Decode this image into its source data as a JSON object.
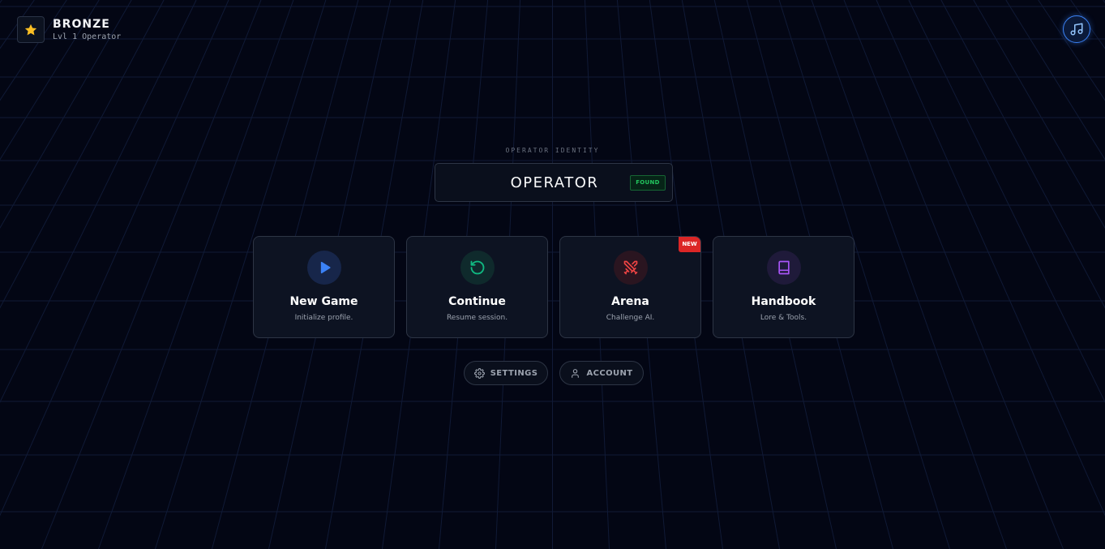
{
  "rank": {
    "title": "BRONZE",
    "subtitle": "Lvl 1 Operator",
    "icon": "star-icon"
  },
  "music": {
    "icon": "music-note-icon"
  },
  "identity": {
    "label": "OPERATOR IDENTITY",
    "name": "OPERATOR",
    "status": "FOUND"
  },
  "cards": [
    {
      "title": "New Game",
      "desc": "Initialize profile.",
      "icon": "play-icon",
      "color": "#3b82f6"
    },
    {
      "title": "Continue",
      "desc": "Resume session.",
      "icon": "restart-icon",
      "color": "#10b981"
    },
    {
      "title": "Arena",
      "desc": "Challenge AI.",
      "icon": "crossed-swords-icon",
      "color": "#ef4444",
      "badge": "NEW"
    },
    {
      "title": "Handbook",
      "desc": "Lore & Tools.",
      "icon": "book-icon",
      "color": "#a855f7"
    }
  ],
  "buttons": {
    "settings": "SETTINGS",
    "account": "ACCOUNT"
  },
  "colors": {
    "background": "#030614",
    "accent": "#3b82f6",
    "found": "#22c55e",
    "badge": "#dc2626",
    "star": "#fbbf24"
  }
}
